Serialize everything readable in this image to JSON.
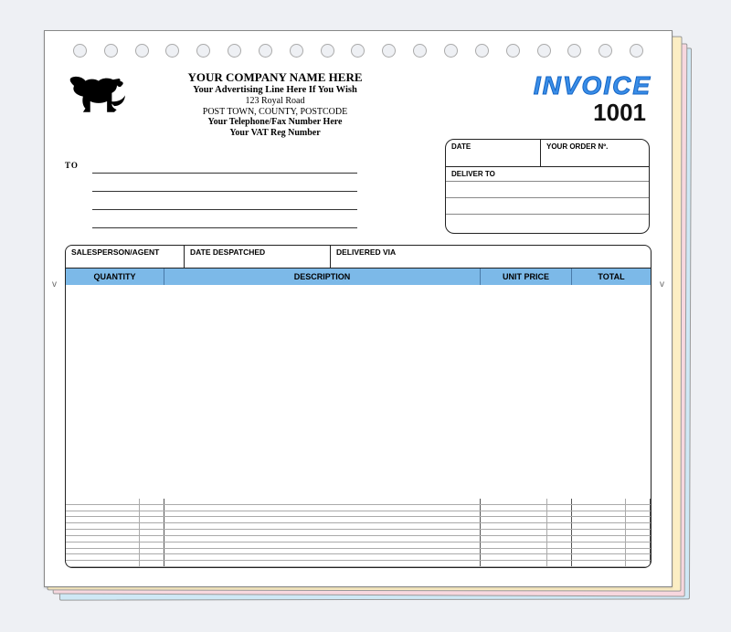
{
  "doc_title": "INVOICE",
  "invoice_number": "1001",
  "company": {
    "name": "YOUR COMPANY NAME HERE",
    "advertising_line": "Your Advertising Line Here If You Wish",
    "address_line": "123 Royal Road",
    "town_line": "POST TOWN, COUNTY, POSTCODE",
    "phone_line": "Your Telephone/Fax Number Here",
    "vat_line": "Your VAT Reg Number"
  },
  "to_label": "TO",
  "order_box": {
    "date_label": "DATE",
    "order_label": "YOUR ORDER Nº.",
    "deliver_label": "DELIVER TO"
  },
  "ship_row": {
    "salesperson": "SALESPERSON/AGENT",
    "despatched": "DATE DESPATCHED",
    "delivered_via": "DELIVERED VIA"
  },
  "columns": {
    "quantity": "QUANTITY",
    "description": "DESCRIPTION",
    "unit_price": "UNIT PRICE",
    "total": "TOTAL"
  },
  "tick_mark": "v"
}
